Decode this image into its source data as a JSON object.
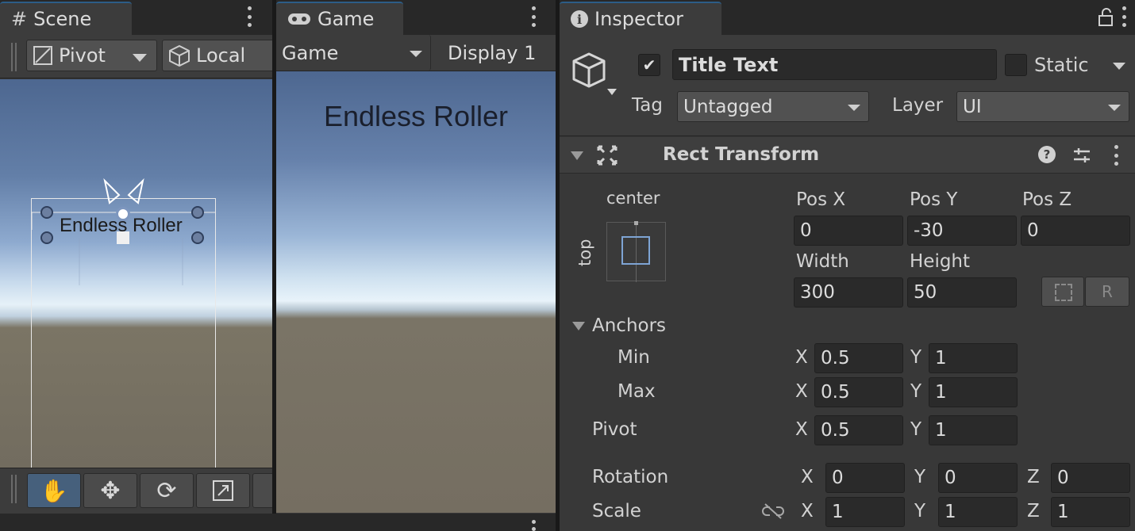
{
  "scene": {
    "tab_label": "Scene",
    "pivot_label": "Pivot",
    "local_label": "Local",
    "text_label": "Endless Roller",
    "tools": [
      "hand-tool",
      "move-tool",
      "rotate-tool",
      "scale-tool"
    ]
  },
  "game": {
    "tab_label": "Game",
    "view_label": "Game",
    "display_label": "Display 1",
    "title_text": "Endless Roller"
  },
  "inspector": {
    "tab_label": "Inspector",
    "object_active": true,
    "object_name": "Title Text",
    "static_label": "Static",
    "tag_label": "Tag",
    "tag_value": "Untagged",
    "layer_label": "Layer",
    "layer_value": "UI",
    "component_title": "Rect Transform",
    "anchor_preset_h": "center",
    "anchor_preset_v": "top",
    "pos_x_label": "Pos X",
    "pos_y_label": "Pos Y",
    "pos_z_label": "Pos Z",
    "pos_x": "0",
    "pos_y": "-30",
    "pos_z": "0",
    "width_label": "Width",
    "height_label": "Height",
    "width": "300",
    "height": "50",
    "raw_edit_label": "R",
    "anchors_label": "Anchors",
    "min_label": "Min",
    "max_label": "Max",
    "pivot_label": "Pivot",
    "rotation_label": "Rotation",
    "scale_label": "Scale",
    "x_label": "X",
    "y_label": "Y",
    "z_label": "Z",
    "anchor_min_x": "0.5",
    "anchor_min_y": "1",
    "anchor_max_x": "0.5",
    "anchor_max_y": "1",
    "pivot_x": "0.5",
    "pivot_y": "1",
    "rotation_x": "0",
    "rotation_y": "0",
    "rotation_z": "0",
    "scale_x": "1",
    "scale_y": "1",
    "scale_z": "1"
  },
  "colors": {
    "accent_tab": "#2c5d87",
    "active_tool": "#46607c",
    "panel_bg": "#383838",
    "field_bg": "#2a2a2a"
  }
}
